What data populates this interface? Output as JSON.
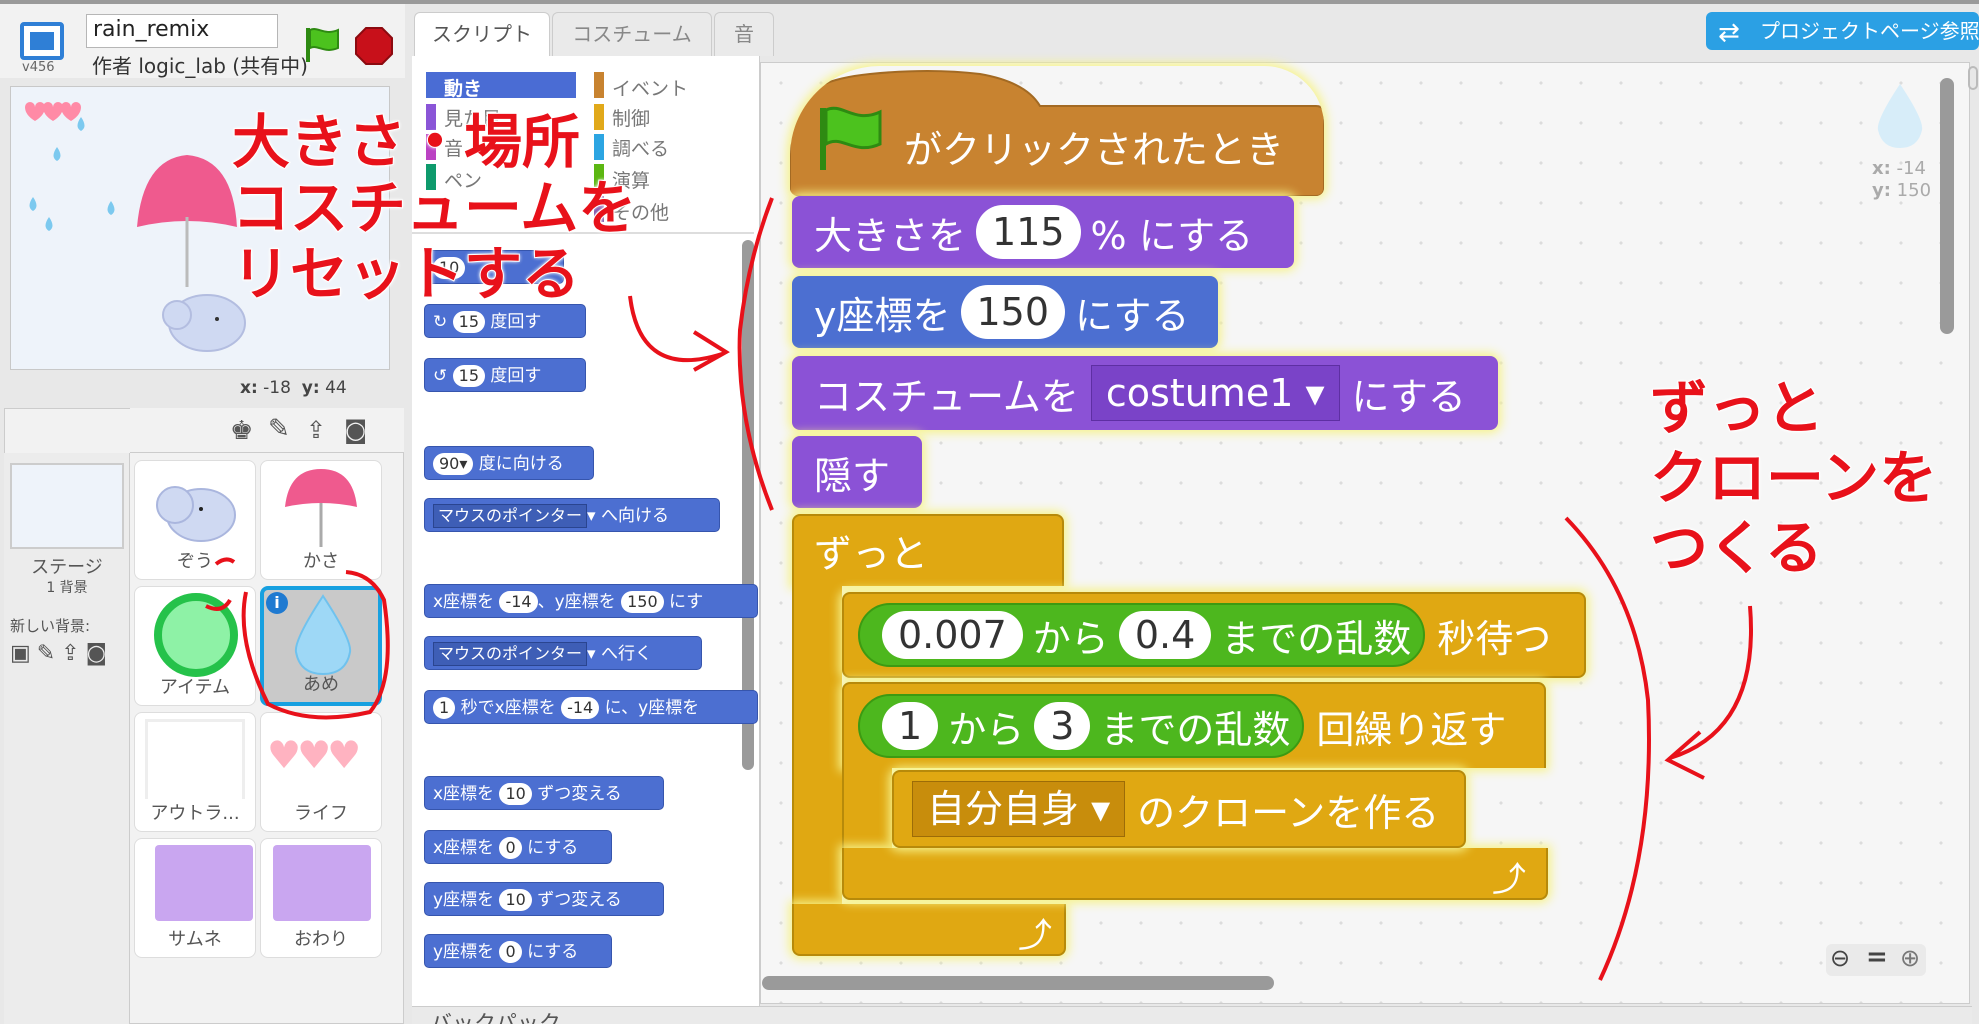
{
  "header": {
    "version": "v456",
    "project_title": "rain_remix",
    "author": "作者 logic_lab (共有中)"
  },
  "stage": {
    "coords_x_label": "x:",
    "coords_x": "-18",
    "coords_y_label": "y:",
    "coords_y": "44"
  },
  "sprites": {
    "stage_label": "ステージ",
    "stage_backdrops": "1 背景",
    "new_backdrop_label": "新しい背景:",
    "items": [
      {
        "name": "ぞう"
      },
      {
        "name": "かさ"
      },
      {
        "name": "アイテム"
      },
      {
        "name": "あめ"
      },
      {
        "name": "アウトラ..."
      },
      {
        "name": "ライフ"
      },
      {
        "name": "サムネ"
      },
      {
        "name": "おわり"
      }
    ]
  },
  "tabs": [
    {
      "label": "スクリプト"
    },
    {
      "label": "コスチューム"
    },
    {
      "label": "音"
    }
  ],
  "categories": {
    "left": [
      {
        "label": "動き",
        "color": "#4a6cd4"
      },
      {
        "label": "見た目",
        "color": "#8a55d7"
      },
      {
        "label": "音",
        "color": "#bb42c3"
      },
      {
        "label": "ペン",
        "color": "#0e9a6c"
      }
    ],
    "right": [
      {
        "label": "イベント",
        "color": "#c88330"
      },
      {
        "label": "制御",
        "color": "#e1a91a"
      },
      {
        "label": "調べる",
        "color": "#2ca5e2"
      },
      {
        "label": "演算",
        "color": "#5cb712"
      },
      {
        "label": "その他",
        "color": "#632d99"
      }
    ]
  },
  "palette": {
    "move_steps": "10",
    "turn_right_deg": "15",
    "turn_right_text": "度回す",
    "turn_left_deg": "15",
    "turn_left_text": "度回す",
    "point_dir_val": "90▾",
    "point_dir_text": "度に向ける",
    "point_towards_dd": "マウスのポインター",
    "point_towards_text": "へ向ける",
    "goto_xy_a": "x座標を",
    "goto_xy_x": "-14",
    "goto_xy_b": "、y座標を",
    "goto_xy_y": "150",
    "goto_xy_c": "にす",
    "goto_dd": "マウスのポインター",
    "goto_text": "へ行く",
    "glide_secs": "1",
    "glide_a": "秒でx座標を",
    "glide_x": "-14",
    "glide_b": "に、y座標を",
    "change_x_a": "x座標を",
    "change_x_val": "10",
    "change_x_b": "ずつ変える",
    "set_x_a": "x座標を",
    "set_x_val": "0",
    "set_x_b": "にする",
    "change_y_a": "y座標を",
    "change_y_val": "10",
    "change_y_b": "ずつ変える",
    "set_y_a": "y座標を",
    "set_y_val": "0",
    "set_y_b": "にする"
  },
  "script": {
    "hat_text": "がクリックされたとき",
    "size_a": "大きさを",
    "size_val": "115",
    "size_b": "% にする",
    "y_a": "y座標を",
    "y_val": "150",
    "y_b": "にする",
    "costume_a": "コスチュームを",
    "costume_val": "costume1",
    "costume_b": "にする",
    "hide": "隠す",
    "forever": "ずっと",
    "rand1_a": "0.007",
    "rand1_from": "から",
    "rand1_b": "0.4",
    "rand1_to": "までの乱数",
    "wait_text": "秒待つ",
    "rand2_a": "1",
    "rand2_from": "から",
    "rand2_b": "3",
    "rand2_to": "までの乱数",
    "repeat_text": "回繰り返す",
    "clone_val": "自分自身",
    "clone_text": "のクローンを作る"
  },
  "project_page_button": "プロジェクトページ参照",
  "sprite_info": {
    "x_label": "x:",
    "x": "-14",
    "y_label": "y:",
    "y": "150"
  },
  "backpack": "バックパック",
  "annotations": {
    "reset_line1": "大きさ・場所",
    "reset_line2": "コスチュームを",
    "reset_line3": "リセットする",
    "clone_line1": "ずっと",
    "clone_line2": "クローンを",
    "clone_line3": "つくる"
  }
}
